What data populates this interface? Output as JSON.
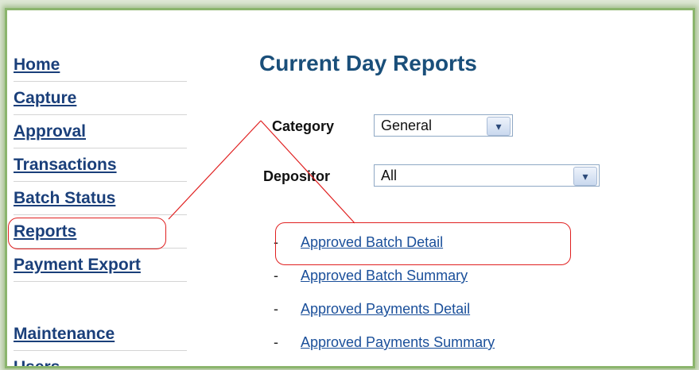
{
  "nav": {
    "items": [
      {
        "label": "Home"
      },
      {
        "label": "Capture"
      },
      {
        "label": "Approval"
      },
      {
        "label": "Transactions"
      },
      {
        "label": "Batch Status"
      },
      {
        "label": "Reports"
      },
      {
        "label": "Payment Export"
      }
    ],
    "secondary": [
      {
        "label": "Maintenance"
      },
      {
        "label": "Users"
      }
    ]
  },
  "page": {
    "title": "Current Day Reports"
  },
  "filters": {
    "category_label": "Category",
    "category_value": "General",
    "depositor_label": "Depositor",
    "depositor_value": "All"
  },
  "reports": [
    {
      "label": "Approved Batch Detail"
    },
    {
      "label": "Approved Batch Summary"
    },
    {
      "label": "Approved Payments Detail"
    },
    {
      "label": "Approved Payments Summary"
    }
  ],
  "icons": {
    "dropdown_arrow": "chevron-down-icon"
  },
  "colors": {
    "frame_border": "#8bb56d",
    "nav_link": "#1a3f7a",
    "title": "#1a4f7a",
    "report_link": "#1a4f9a",
    "annotation": "#e02020"
  }
}
